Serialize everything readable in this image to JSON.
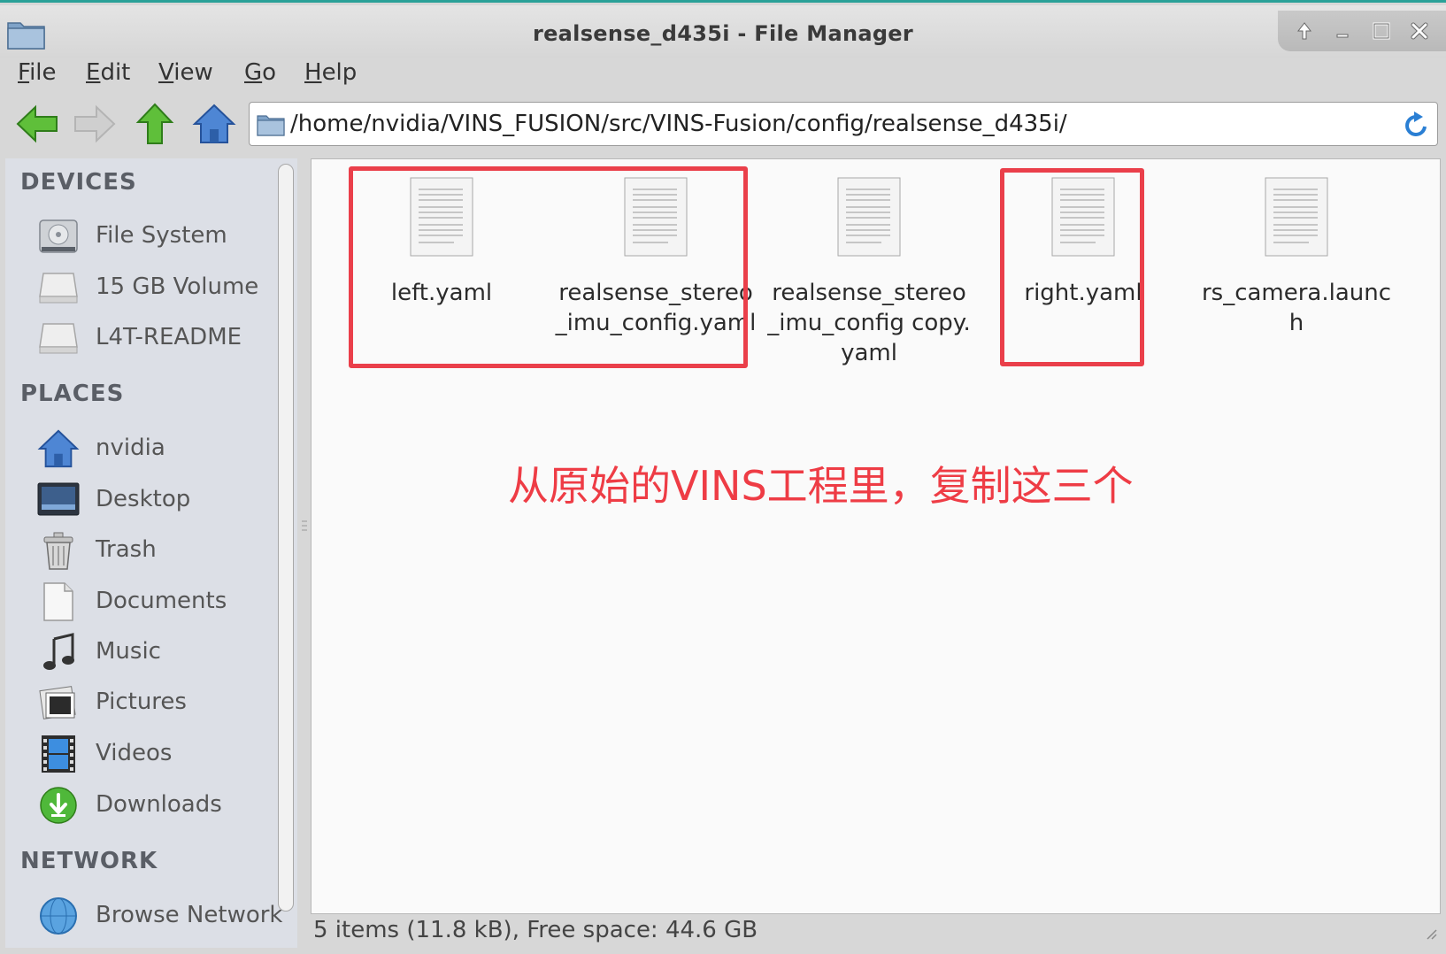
{
  "window": {
    "title": "realsense_d435i - File Manager",
    "title_icon": "folder-icon",
    "controls": [
      "up-arrow-icon",
      "minimize-icon",
      "maximize-icon",
      "close-icon"
    ]
  },
  "menubar": {
    "items": [
      {
        "mnemonic": "F",
        "rest": "ile"
      },
      {
        "mnemonic": "E",
        "rest": "dit"
      },
      {
        "mnemonic": "V",
        "rest": "iew"
      },
      {
        "mnemonic": "G",
        "rest": "o"
      },
      {
        "mnemonic": "H",
        "rest": "elp"
      }
    ]
  },
  "toolbar": {
    "path": "/home/nvidia/VINS_FUSION/src/VINS-Fusion/config/realsense_d435i/",
    "buttons": [
      "back-arrow-icon",
      "forward-arrow-icon",
      "up-arrow-icon",
      "home-icon"
    ],
    "reload_icon": "reload-icon"
  },
  "sidebar": {
    "devices_title": "DEVICES",
    "devices": [
      {
        "label": "File System",
        "icon": "harddisk-icon"
      },
      {
        "label": "15 GB Volume",
        "icon": "drive-icon"
      },
      {
        "label": "L4T-README",
        "icon": "drive-icon"
      }
    ],
    "places_title": "PLACES",
    "places": [
      {
        "label": "nvidia",
        "icon": "home-icon"
      },
      {
        "label": "Desktop",
        "icon": "desktop-icon"
      },
      {
        "label": "Trash",
        "icon": "trash-icon"
      },
      {
        "label": "Documents",
        "icon": "document-icon"
      },
      {
        "label": "Music",
        "icon": "music-icon"
      },
      {
        "label": "Pictures",
        "icon": "pictures-icon"
      },
      {
        "label": "Videos",
        "icon": "videos-icon"
      },
      {
        "label": "Downloads",
        "icon": "downloads-icon"
      }
    ],
    "network_title": "NETWORK",
    "network": [
      {
        "label": "Browse Network",
        "icon": "network-icon"
      }
    ]
  },
  "files": [
    {
      "name": "left.yaml",
      "icon": "text-file-icon"
    },
    {
      "name": "realsense_stereo_imu_config.yaml",
      "icon": "text-file-icon"
    },
    {
      "name": "realsense_stereo_imu_config copy.yaml",
      "icon": "text-file-icon"
    },
    {
      "name": "right.yaml",
      "icon": "text-file-icon"
    },
    {
      "name": "rs_camera.launch",
      "icon": "text-file-icon"
    }
  ],
  "annotation": {
    "text": "从原始的VINS工程里，复制这三个",
    "color": "#ee3c45"
  },
  "status": {
    "text": "5 items (11.8 kB), Free space: 44.6 GB"
  },
  "colors": {
    "highlight": "#ea3f4a",
    "accent": "#2aa198"
  }
}
